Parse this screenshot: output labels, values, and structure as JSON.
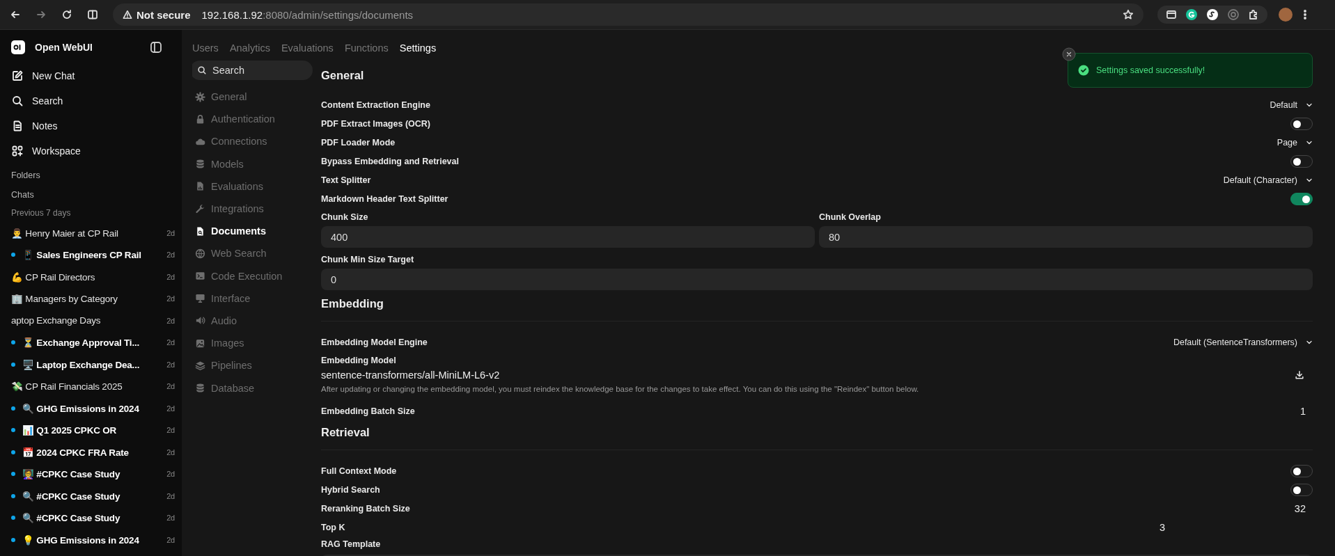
{
  "browser": {
    "security": "Not secure",
    "url_host": "192.168.1.92",
    "url_path": ":8080/admin/settings/documents"
  },
  "sidebar": {
    "app_name": "Open WebUI",
    "nav": [
      {
        "kind": "new-chat",
        "label": "New Chat"
      },
      {
        "kind": "search",
        "label": "Search"
      },
      {
        "kind": "notes",
        "label": "Notes"
      },
      {
        "kind": "workspace",
        "label": "Workspace"
      }
    ],
    "sections": [
      "Folders",
      "Chats"
    ],
    "group_label": "Previous 7 days",
    "chats": [
      {
        "title": "👨‍💼 Henry Maier at CP Rail",
        "time": "2d",
        "unread": false
      },
      {
        "title": "📱 Sales Engineers CP Rail",
        "time": "2d",
        "unread": true
      },
      {
        "title": "💪 CP Rail Directors",
        "time": "2d",
        "unread": false
      },
      {
        "title": "🏢 Managers by Category",
        "time": "2d",
        "unread": false
      },
      {
        "title": "aptop Exchange Days",
        "time": "2d",
        "unread": false
      },
      {
        "title": "⏳ Exchange Approval Ti...",
        "time": "2d",
        "unread": true
      },
      {
        "title": "🖥️ Laptop Exchange Dea...",
        "time": "2d",
        "unread": true
      },
      {
        "title": "💸 CP Rail Financials 2025",
        "time": "2d",
        "unread": false
      },
      {
        "title": "🔍 GHG Emissions in 2024",
        "time": "2d",
        "unread": true
      },
      {
        "title": "📊 Q1 2025 CPKC OR",
        "time": "2d",
        "unread": true
      },
      {
        "title": "📅 2024 CPKC FRA Rate",
        "time": "2d",
        "unread": true
      },
      {
        "title": "👩‍🏫 #CPKC Case Study",
        "time": "2d",
        "unread": true
      },
      {
        "title": "🔍 #CPKC Case Study",
        "time": "2d",
        "unread": true
      },
      {
        "title": "🔍 #CPKC Case Study",
        "time": "2d",
        "unread": true
      },
      {
        "title": "💡 GHG Emissions in 2024",
        "time": "2d",
        "unread": true
      }
    ]
  },
  "admin_tabs": [
    {
      "label": "Users",
      "selected": false
    },
    {
      "label": "Analytics",
      "selected": false
    },
    {
      "label": "Evaluations",
      "selected": false
    },
    {
      "label": "Functions",
      "selected": false
    },
    {
      "label": "Settings",
      "selected": true
    }
  ],
  "settings_nav": {
    "search_placeholder": "Search",
    "items": [
      {
        "kind": "gear",
        "label": "General",
        "selected": false
      },
      {
        "kind": "lock",
        "label": "Authentication",
        "selected": false
      },
      {
        "kind": "cloud",
        "label": "Connections",
        "selected": false
      },
      {
        "kind": "db",
        "label": "Models",
        "selected": false
      },
      {
        "kind": "chart-doc",
        "label": "Evaluations",
        "selected": false
      },
      {
        "kind": "wrench",
        "label": "Integrations",
        "selected": false
      },
      {
        "kind": "doc",
        "label": "Documents",
        "selected": true
      },
      {
        "kind": "globe",
        "label": "Web Search",
        "selected": false
      },
      {
        "kind": "terminal",
        "label": "Code Execution",
        "selected": false
      },
      {
        "kind": "monitor",
        "label": "Interface",
        "selected": false
      },
      {
        "kind": "speaker",
        "label": "Audio",
        "selected": false
      },
      {
        "kind": "image",
        "label": "Images",
        "selected": false
      },
      {
        "kind": "layers",
        "label": "Pipelines",
        "selected": false
      },
      {
        "kind": "db",
        "label": "Database",
        "selected": false
      }
    ]
  },
  "sections": [
    {
      "title": "General",
      "rows": [
        {
          "kind": "select",
          "label": "Content Extraction Engine",
          "value": "Default"
        },
        {
          "kind": "toggle",
          "label": "PDF Extract Images (OCR)",
          "on": false
        },
        {
          "kind": "select",
          "label": "PDF Loader Mode",
          "value": "Page"
        },
        {
          "kind": "toggle",
          "label": "Bypass Embedding and Retrieval",
          "on": false
        },
        {
          "kind": "select",
          "label": "Text Splitter",
          "value": "Default (Character)"
        },
        {
          "kind": "toggle",
          "label": "Markdown Header Text Splitter",
          "on": true
        },
        {
          "kind": "fields",
          "fields": [
            {
              "label": "Chunk Size",
              "value": "400"
            },
            {
              "label": "Chunk Overlap",
              "value": "80"
            }
          ]
        },
        {
          "kind": "fields",
          "fields": [
            {
              "label": "Chunk Min Size Target",
              "value": "0"
            }
          ]
        }
      ]
    },
    {
      "title": "Embedding",
      "rows": [
        {
          "kind": "select",
          "label": "Embedding Model Engine",
          "value": "Default (SentenceTransformers)"
        },
        {
          "kind": "model",
          "label": "Embedding Model",
          "value": "sentence-transformers/all-MiniLM-L6-v2",
          "note": "After updating or changing the embedding model, you must reindex the knowledge base for the changes to take effect. You can do this using the \"Reindex\" button below."
        },
        {
          "kind": "number",
          "label": "Embedding Batch Size",
          "value": "1"
        }
      ]
    },
    {
      "title": "Retrieval",
      "rows": [
        {
          "kind": "toggle",
          "label": "Full Context Mode",
          "on": false
        },
        {
          "kind": "toggle",
          "label": "Hybrid Search",
          "on": false
        },
        {
          "kind": "number",
          "label": "Reranking Batch Size",
          "value": "32"
        },
        {
          "kind": "number-field",
          "label": "Top K",
          "value": "3"
        },
        {
          "kind": "textarea",
          "label": "RAG Template"
        }
      ]
    }
  ],
  "toast": {
    "message": "Settings saved successfully!"
  }
}
